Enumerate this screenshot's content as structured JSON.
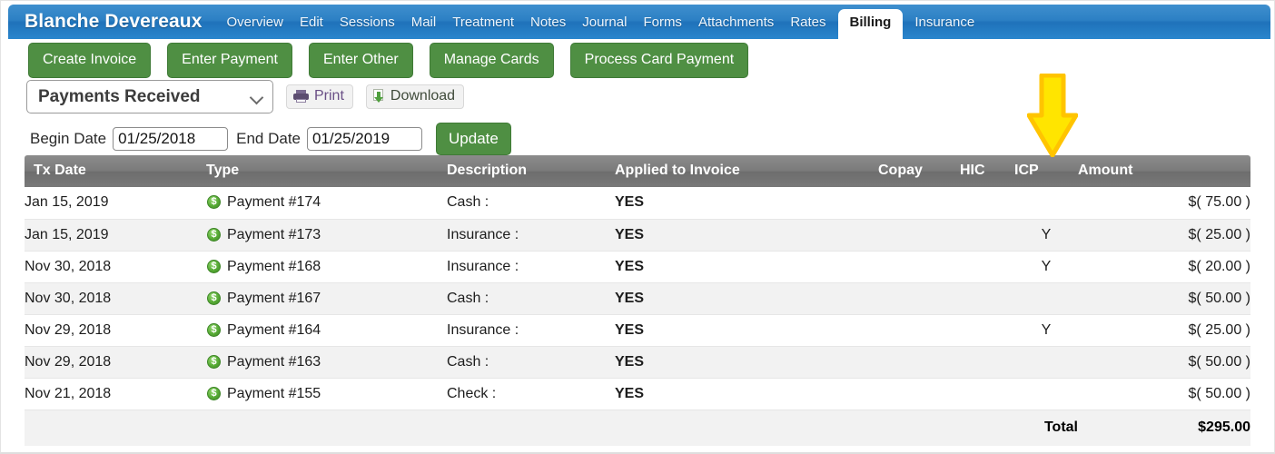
{
  "nav": {
    "patient_name": "Blanche Devereaux",
    "items": [
      {
        "label": "Overview",
        "active": false
      },
      {
        "label": "Edit",
        "active": false
      },
      {
        "label": "Sessions",
        "active": false
      },
      {
        "label": "Mail",
        "active": false
      },
      {
        "label": "Treatment",
        "active": false
      },
      {
        "label": "Notes",
        "active": false
      },
      {
        "label": "Journal",
        "active": false
      },
      {
        "label": "Forms",
        "active": false
      },
      {
        "label": "Attachments",
        "active": false
      },
      {
        "label": "Rates",
        "active": false
      },
      {
        "label": "Billing",
        "active": true
      },
      {
        "label": "Insurance",
        "active": false
      }
    ]
  },
  "actions": [
    {
      "label": "Create Invoice"
    },
    {
      "label": "Enter Payment"
    },
    {
      "label": "Enter Other"
    },
    {
      "label": "Manage Cards"
    },
    {
      "label": "Process Card Payment"
    }
  ],
  "toolbar": {
    "report_select_value": "Payments Received",
    "report_select_icon": "chevron-down-icon",
    "print_label": "Print",
    "print_icon": "printer-icon",
    "download_label": "Download",
    "download_icon": "download-icon"
  },
  "filters": {
    "begin_date_label": "Begin Date",
    "begin_date_value": "01/25/2018",
    "end_date_label": "End Date",
    "end_date_value": "01/25/2019",
    "update_label": "Update"
  },
  "table": {
    "columns": [
      "Tx Date",
      "Type",
      "Description",
      "Applied to Invoice",
      "Copay",
      "HIC",
      "ICP",
      "Amount"
    ],
    "rows": [
      {
        "date": "Jan 15, 2019",
        "type_icon": "dollar-coin-icon",
        "type": "Payment #174",
        "description": "Cash :",
        "applied": "YES",
        "copay": "",
        "hic": "",
        "icp": "",
        "amount": "$( 75.00 )"
      },
      {
        "date": "Jan 15, 2019",
        "type_icon": "dollar-coin-icon",
        "type": "Payment #173",
        "description": "Insurance :",
        "applied": "YES",
        "copay": "",
        "hic": "",
        "icp": "Y",
        "amount": "$( 25.00 )"
      },
      {
        "date": "Nov 30, 2018",
        "type_icon": "dollar-coin-icon",
        "type": "Payment #168",
        "description": "Insurance :",
        "applied": "YES",
        "copay": "",
        "hic": "",
        "icp": "Y",
        "amount": "$( 20.00 )"
      },
      {
        "date": "Nov 30, 2018",
        "type_icon": "dollar-coin-icon",
        "type": "Payment #167",
        "description": "Cash :",
        "applied": "YES",
        "copay": "",
        "hic": "",
        "icp": "",
        "amount": "$( 50.00 )"
      },
      {
        "date": "Nov 29, 2018",
        "type_icon": "dollar-coin-icon",
        "type": "Payment #164",
        "description": "Insurance :",
        "applied": "YES",
        "copay": "",
        "hic": "",
        "icp": "Y",
        "amount": "$( 25.00 )"
      },
      {
        "date": "Nov 29, 2018",
        "type_icon": "dollar-coin-icon",
        "type": "Payment #163",
        "description": "Cash :",
        "applied": "YES",
        "copay": "",
        "hic": "",
        "icp": "",
        "amount": "$( 50.00 )"
      },
      {
        "date": "Nov 21, 2018",
        "type_icon": "dollar-coin-icon",
        "type": "Payment #155",
        "description": "Check :",
        "applied": "YES",
        "copay": "",
        "hic": "",
        "icp": "",
        "amount": "$( 50.00 )"
      }
    ],
    "total_label": "Total",
    "total_amount": "$295.00"
  },
  "annotation": {
    "arrow_icon": "down-arrow-icon",
    "arrow_target_column": "ICP",
    "arrow_fill": "#FFE500",
    "arrow_stroke": "#FFC400"
  },
  "colors": {
    "nav_blue": "#2C80C4",
    "button_green": "#4F8F43",
    "header_gray": "#7A7A7A",
    "yes_green": "#2D5E2D",
    "row_alt": "#F2F2F2"
  }
}
